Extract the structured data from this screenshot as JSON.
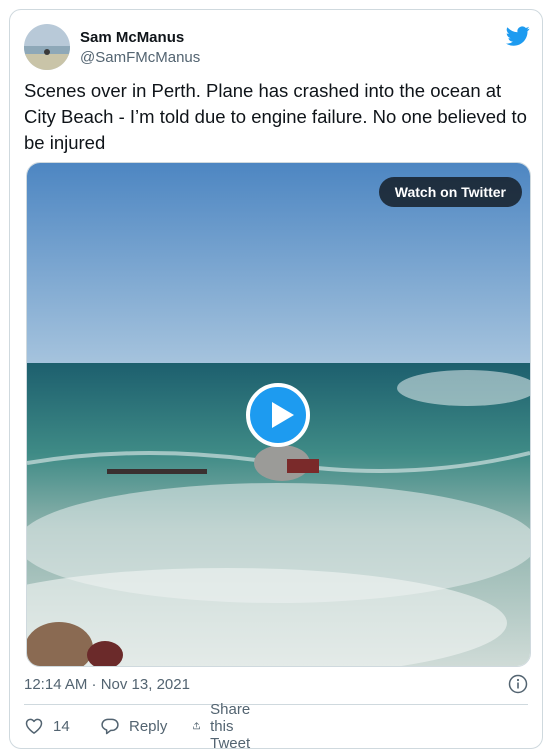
{
  "user": {
    "name": "Sam McManus",
    "handle": "@SamFMcManus"
  },
  "tweet": {
    "text": "Scenes over in Perth. Plane has crashed into the ocean at City Beach - I’m told due to engine failure. No one believed to be injured"
  },
  "media": {
    "watch_label": "Watch on Twitter"
  },
  "meta": {
    "timestamp": "12:14 AM · Nov 13, 2021"
  },
  "actions": {
    "like_count": "14",
    "reply_label": "Reply",
    "share_label": "Share this Tweet"
  },
  "icons": {
    "logo": "twitter-bird-icon",
    "info": "info-icon",
    "like": "heart-icon",
    "reply": "reply-bubble-icon",
    "share": "share-icon",
    "play": "play-icon"
  },
  "colors": {
    "brand": "#1d9bf0",
    "text": "#0f1419",
    "muted": "#536471",
    "border": "#cfd9de"
  }
}
